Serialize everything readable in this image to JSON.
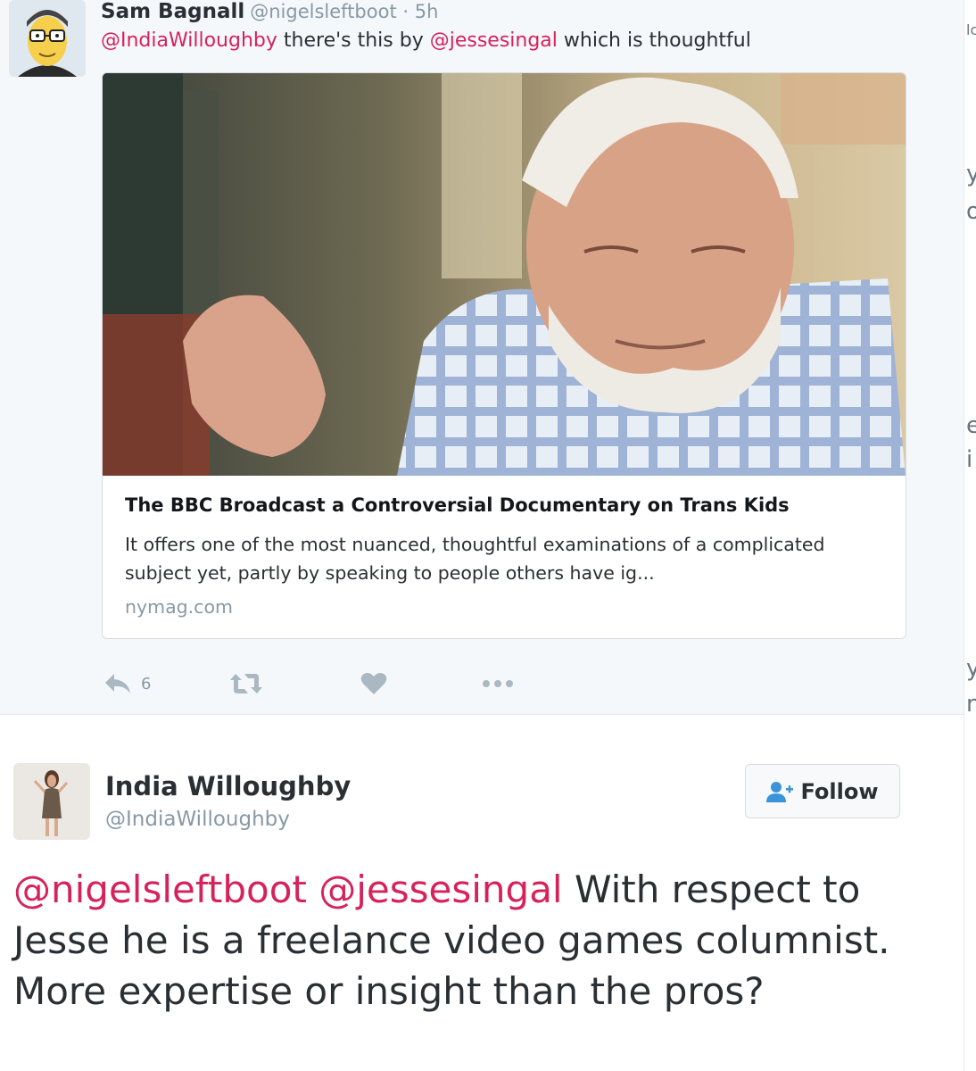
{
  "reply": {
    "author_name": "Sam Bagnall",
    "author_handle": "@nigelsleftboot",
    "time_sep": "·",
    "time": "5h",
    "mention_1": "@IndiaWilloughby",
    "text_1": " there's this by ",
    "mention_2": "@jessesingal",
    "text_2": " which is thoughtful",
    "avatar_icon": "cartoon-avatar-icon",
    "card": {
      "title": "The BBC Broadcast a Controversial Documentary on Trans Kids",
      "description": "It offers one of the most nuanced, thoughtful examinations of a complicated subject yet, partly by speaking to people others have ig...",
      "domain": "nymag.com"
    },
    "actions": {
      "reply_count": "6",
      "reply_icon": "reply-icon",
      "retweet_icon": "retweet-icon",
      "like_icon": "heart-icon",
      "more_icon": "more-dots-icon"
    }
  },
  "tweet": {
    "author_name": "India Willoughby",
    "author_handle": "@IndiaWilloughby",
    "follow_label": "Follow",
    "follow_icon": "follow-person-icon",
    "mention_1": "@nigelsleftboot",
    "mention_2": "@jessesingal",
    "text": " With respect to Jesse he is a freelance video games columnist. More expertise or insight than the pros?"
  },
  "right_edge": {
    "glyphs": [
      "lc",
      "y",
      "of",
      "e",
      "i",
      "y",
      "n"
    ]
  },
  "colors": {
    "mention": "#d6225b",
    "reply_bg": "#f5f8fa",
    "muted": "#8899a6",
    "icon": "#aab8c2"
  }
}
